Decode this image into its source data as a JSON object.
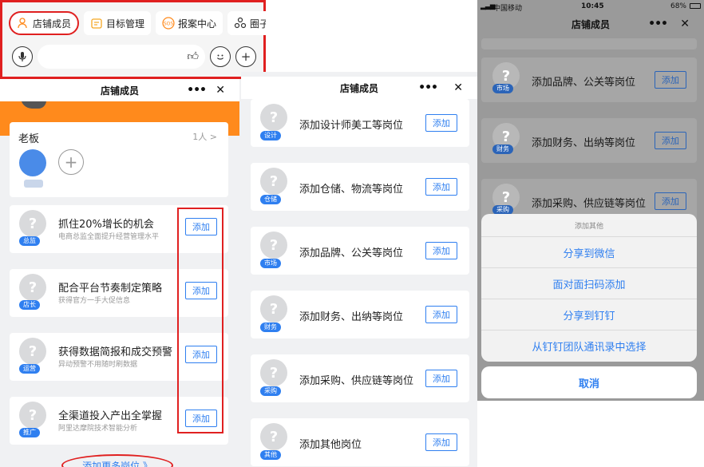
{
  "panel1": {
    "tabs": [
      {
        "label": "店铺成员",
        "icon": "people-icon"
      },
      {
        "label": "目标管理",
        "icon": "calendar-icon"
      },
      {
        "label": "报案中心",
        "icon": "sos-icon"
      },
      {
        "label": "圈子",
        "icon": "circle-group-icon"
      }
    ],
    "header": {
      "title": "店铺成员",
      "more": "•••",
      "close": "✕"
    },
    "boss": {
      "title": "老板",
      "count": "1人 >"
    },
    "roles": [
      {
        "title": "抓住20%增长的机会",
        "subtitle": "电商总监全面提升经营管理水平",
        "badge": "总监",
        "button": "添加"
      },
      {
        "title": "配合平台节奏制定策略",
        "subtitle": "获得官方一手大促信息",
        "badge": "店长",
        "button": "添加"
      },
      {
        "title": "获得数据简报和成交预警",
        "subtitle": "异动预警不用随时刷数据",
        "badge": "运营",
        "button": "添加"
      },
      {
        "title": "全渠道投入产出全掌握",
        "subtitle": "阿里达摩院技术智能分析",
        "badge": "推广",
        "button": "添加"
      }
    ],
    "more_link": "添加更多岗位 》"
  },
  "panel2": {
    "header": {
      "title": "店铺成员",
      "more": "•••",
      "close": "✕"
    },
    "items": [
      {
        "label": "添加设计师美工等岗位",
        "badge": "设计",
        "button": "添加"
      },
      {
        "label": "添加仓储、物流等岗位",
        "badge": "仓储",
        "button": "添加"
      },
      {
        "label": "添加品牌、公关等岗位",
        "badge": "市场",
        "button": "添加"
      },
      {
        "label": "添加财务、出纳等岗位",
        "badge": "财务",
        "button": "添加"
      },
      {
        "label": "添加采购、供应链等岗位",
        "badge": "采购",
        "button": "添加"
      },
      {
        "label": "添加其他岗位",
        "badge": "其他",
        "button": "添加"
      }
    ]
  },
  "panel3": {
    "status": {
      "carrier": "中国移动",
      "time": "10:45",
      "battery": "68%"
    },
    "header": {
      "title": "店铺成员",
      "more": "•••",
      "close": "✕"
    },
    "items": [
      {
        "label": "添加品牌、公关等岗位",
        "badge": "市场",
        "button": "添加"
      },
      {
        "label": "添加财务、出纳等岗位",
        "badge": "财务",
        "button": "添加"
      },
      {
        "label": "添加采购、供应链等岗位",
        "badge": "采购",
        "button": "添加"
      }
    ],
    "sheet": {
      "title": "添加其他",
      "options": [
        "分享到微信",
        "面对面扫码添加",
        "分享到钉钉",
        "从钉钉团队通讯录中选择"
      ],
      "cancel": "取消"
    }
  },
  "colors": {
    "accent": "#2f7ff0",
    "highlight": "#e02020",
    "orange": "#ff8a1c"
  }
}
